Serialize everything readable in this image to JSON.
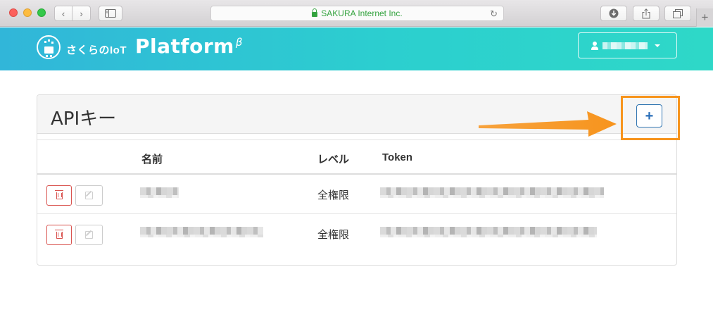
{
  "browser": {
    "url_text": "SAKURA Internet Inc.",
    "new_tab_symbol": "+"
  },
  "header": {
    "brand_small": "さくらのIoT",
    "brand_big": "Platform",
    "brand_suffix": "β"
  },
  "panel": {
    "title": "APIキー",
    "add_button_label": "+"
  },
  "table": {
    "columns": [
      "名前",
      "レベル",
      "Token"
    ],
    "rows": [
      {
        "level": "全権限"
      },
      {
        "level": "全権限"
      }
    ]
  },
  "colors": {
    "header_gradient_start": "#31b6d9",
    "header_gradient_end": "#2ed8c8",
    "annotation": "#f7941d",
    "danger": "#d9534f",
    "primary": "#3276b1"
  }
}
